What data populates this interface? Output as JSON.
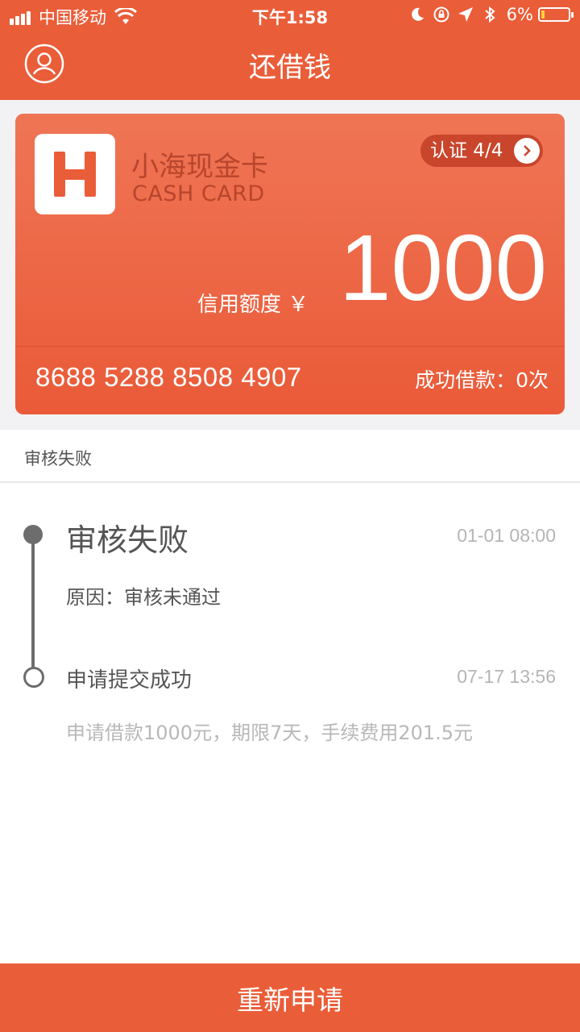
{
  "status_bar": {
    "carrier": "中国移动",
    "time": "下午1:58",
    "battery": "6%"
  },
  "nav": {
    "title": "还借钱"
  },
  "card": {
    "logo_letter": "H",
    "name": "小海现金卡",
    "subtitle": "CASH CARD",
    "cert_label": "认证 4/4",
    "credit_label": "信用额度 ￥",
    "credit_value": "1000",
    "card_number": "8688 5288 8508 4907",
    "success_count": "成功借款：0次"
  },
  "section": {
    "title": "审核失败"
  },
  "timeline": [
    {
      "title": "审核失败",
      "time": "01-01 08:00",
      "desc": "原因：审核未通过"
    },
    {
      "title": "申请提交成功",
      "time": "07-17 13:56",
      "desc": "申请借款1000元，期限7天，手续费用201.5元"
    }
  ],
  "actions": {
    "reapply_label": "重新申请"
  },
  "colors": {
    "brand": "#ea5d39",
    "timeline": "#6d6d6d"
  },
  "icons": [
    "signal-icon",
    "wifi-icon",
    "moon-icon",
    "rotation-lock-icon",
    "location-icon",
    "bluetooth-icon",
    "battery-icon",
    "user-icon",
    "chevron-right-icon"
  ]
}
